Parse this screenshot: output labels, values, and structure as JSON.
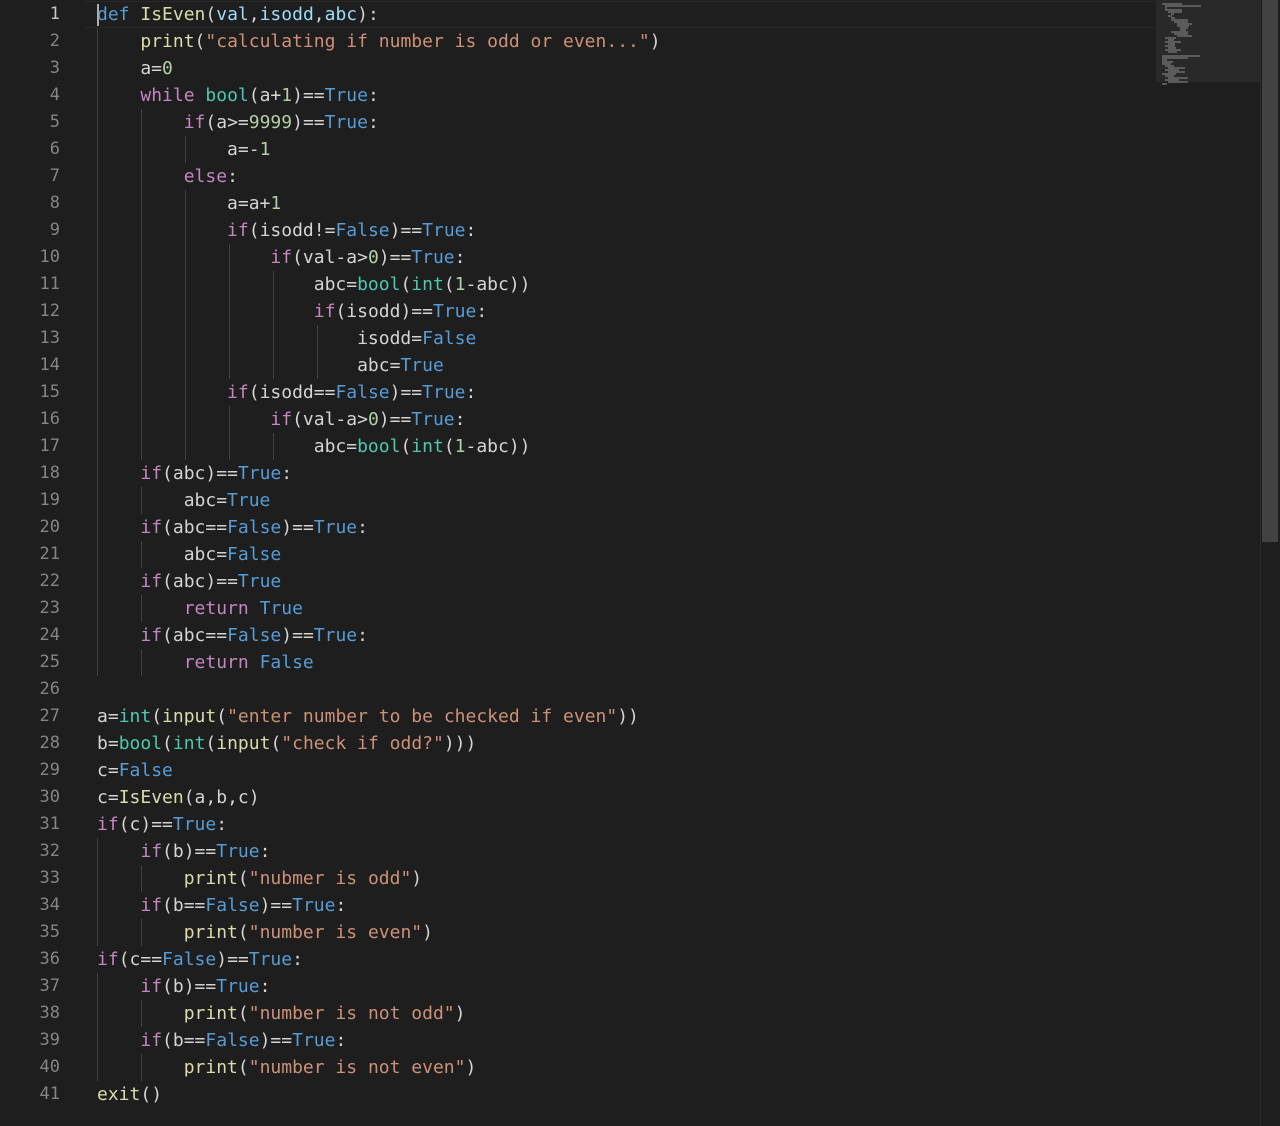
{
  "editor": {
    "active_line": 1,
    "line_numbers": [
      "1",
      "2",
      "3",
      "4",
      "5",
      "6",
      "7",
      "8",
      "9",
      "10",
      "11",
      "12",
      "13",
      "14",
      "15",
      "16",
      "17",
      "18",
      "19",
      "20",
      "21",
      "22",
      "23",
      "24",
      "25",
      "26",
      "27",
      "28",
      "29",
      "30",
      "31",
      "32",
      "33",
      "34",
      "35",
      "36",
      "37",
      "38",
      "39",
      "40",
      "41"
    ],
    "lines": [
      [
        [
          "def",
          "k-def"
        ],
        [
          " ",
          ""
        ],
        [
          "IsEven",
          "k-fn"
        ],
        [
          "(",
          ""
        ],
        [
          "val",
          "k-var"
        ],
        [
          ",",
          ""
        ],
        [
          "isodd",
          "k-var"
        ],
        [
          ",",
          ""
        ],
        [
          "abc",
          "k-var"
        ],
        [
          "):",
          ""
        ]
      ],
      [
        [
          "    ",
          ""
        ],
        [
          "print",
          "k-fn"
        ],
        [
          "(",
          ""
        ],
        [
          "\"calculating if number is odd or even...\"",
          "k-str"
        ],
        [
          ")",
          ""
        ]
      ],
      [
        [
          "    a=",
          ""
        ],
        [
          "0",
          "k-num"
        ]
      ],
      [
        [
          "    ",
          ""
        ],
        [
          "while",
          "k-kw"
        ],
        [
          " ",
          ""
        ],
        [
          "bool",
          "k-bi"
        ],
        [
          "(a+",
          ""
        ],
        [
          "1",
          "k-num"
        ],
        [
          ")==",
          ""
        ],
        [
          "True",
          "k-const"
        ],
        [
          ":",
          ""
        ]
      ],
      [
        [
          "        ",
          ""
        ],
        [
          "if",
          "k-kw"
        ],
        [
          "(a>=",
          ""
        ],
        [
          "9999",
          "k-num"
        ],
        [
          ")==",
          ""
        ],
        [
          "True",
          "k-const"
        ],
        [
          ":",
          ""
        ]
      ],
      [
        [
          "            a=-",
          ""
        ],
        [
          "1",
          "k-num"
        ]
      ],
      [
        [
          "        ",
          ""
        ],
        [
          "else",
          "k-kw"
        ],
        [
          ":",
          ""
        ]
      ],
      [
        [
          "            a=a+",
          ""
        ],
        [
          "1",
          "k-num"
        ]
      ],
      [
        [
          "            ",
          ""
        ],
        [
          "if",
          "k-kw"
        ],
        [
          "(isodd!=",
          ""
        ],
        [
          "False",
          "k-const"
        ],
        [
          ")==",
          ""
        ],
        [
          "True",
          "k-const"
        ],
        [
          ":",
          ""
        ]
      ],
      [
        [
          "                ",
          ""
        ],
        [
          "if",
          "k-kw"
        ],
        [
          "(val-a>",
          ""
        ],
        [
          "0",
          "k-num"
        ],
        [
          ")==",
          ""
        ],
        [
          "True",
          "k-const"
        ],
        [
          ":",
          ""
        ]
      ],
      [
        [
          "                    abc=",
          ""
        ],
        [
          "bool",
          "k-bi"
        ],
        [
          "(",
          ""
        ],
        [
          "int",
          "k-bi"
        ],
        [
          "(",
          ""
        ],
        [
          "1",
          "k-num"
        ],
        [
          "-abc))",
          ""
        ]
      ],
      [
        [
          "                    ",
          ""
        ],
        [
          "if",
          "k-kw"
        ],
        [
          "(isodd)==",
          ""
        ],
        [
          "True",
          "k-const"
        ],
        [
          ":",
          ""
        ]
      ],
      [
        [
          "                        isodd=",
          ""
        ],
        [
          "False",
          "k-const"
        ]
      ],
      [
        [
          "                        abc=",
          ""
        ],
        [
          "True",
          "k-const"
        ]
      ],
      [
        [
          "            ",
          ""
        ],
        [
          "if",
          "k-kw"
        ],
        [
          "(isodd==",
          ""
        ],
        [
          "False",
          "k-const"
        ],
        [
          ")==",
          ""
        ],
        [
          "True",
          "k-const"
        ],
        [
          ":",
          ""
        ]
      ],
      [
        [
          "                ",
          ""
        ],
        [
          "if",
          "k-kw"
        ],
        [
          "(val-a>",
          ""
        ],
        [
          "0",
          "k-num"
        ],
        [
          ")==",
          ""
        ],
        [
          "True",
          "k-const"
        ],
        [
          ":",
          ""
        ]
      ],
      [
        [
          "                    abc=",
          ""
        ],
        [
          "bool",
          "k-bi"
        ],
        [
          "(",
          ""
        ],
        [
          "int",
          "k-bi"
        ],
        [
          "(",
          ""
        ],
        [
          "1",
          "k-num"
        ],
        [
          "-abc))",
          ""
        ]
      ],
      [
        [
          "    ",
          ""
        ],
        [
          "if",
          "k-kw"
        ],
        [
          "(abc)==",
          ""
        ],
        [
          "True",
          "k-const"
        ],
        [
          ":",
          ""
        ]
      ],
      [
        [
          "        abc=",
          ""
        ],
        [
          "True",
          "k-const"
        ]
      ],
      [
        [
          "    ",
          ""
        ],
        [
          "if",
          "k-kw"
        ],
        [
          "(abc==",
          ""
        ],
        [
          "False",
          "k-const"
        ],
        [
          ")==",
          ""
        ],
        [
          "True",
          "k-const"
        ],
        [
          ":",
          ""
        ]
      ],
      [
        [
          "        abc=",
          ""
        ],
        [
          "False",
          "k-const"
        ]
      ],
      [
        [
          "    ",
          ""
        ],
        [
          "if",
          "k-kw"
        ],
        [
          "(abc)==",
          ""
        ],
        [
          "True",
          "k-const"
        ]
      ],
      [
        [
          "        ",
          ""
        ],
        [
          "return",
          "k-kw"
        ],
        [
          " ",
          ""
        ],
        [
          "True",
          "k-const"
        ]
      ],
      [
        [
          "    ",
          ""
        ],
        [
          "if",
          "k-kw"
        ],
        [
          "(abc==",
          ""
        ],
        [
          "False",
          "k-const"
        ],
        [
          ")==",
          ""
        ],
        [
          "True",
          "k-const"
        ],
        [
          ":",
          ""
        ]
      ],
      [
        [
          "        ",
          ""
        ],
        [
          "return",
          "k-kw"
        ],
        [
          " ",
          ""
        ],
        [
          "False",
          "k-const"
        ]
      ],
      [],
      [
        [
          "a=",
          ""
        ],
        [
          "int",
          "k-bi"
        ],
        [
          "(",
          ""
        ],
        [
          "input",
          "k-fn"
        ],
        [
          "(",
          ""
        ],
        [
          "\"enter number to be checked if even\"",
          "k-str"
        ],
        [
          "))",
          ""
        ]
      ],
      [
        [
          "b=",
          ""
        ],
        [
          "bool",
          "k-bi"
        ],
        [
          "(",
          ""
        ],
        [
          "int",
          "k-bi"
        ],
        [
          "(",
          ""
        ],
        [
          "input",
          "k-fn"
        ],
        [
          "(",
          ""
        ],
        [
          "\"check if odd?\"",
          "k-str"
        ],
        [
          ")))",
          ""
        ]
      ],
      [
        [
          "c=",
          ""
        ],
        [
          "False",
          "k-const"
        ]
      ],
      [
        [
          "c=",
          ""
        ],
        [
          "IsEven",
          "k-fn"
        ],
        [
          "(a,b,c)",
          ""
        ]
      ],
      [
        [
          "if",
          "k-kw"
        ],
        [
          "(c)==",
          ""
        ],
        [
          "True",
          "k-const"
        ],
        [
          ":",
          ""
        ]
      ],
      [
        [
          "    ",
          ""
        ],
        [
          "if",
          "k-kw"
        ],
        [
          "(b)==",
          ""
        ],
        [
          "True",
          "k-const"
        ],
        [
          ":",
          ""
        ]
      ],
      [
        [
          "        ",
          ""
        ],
        [
          "print",
          "k-fn"
        ],
        [
          "(",
          ""
        ],
        [
          "\"nubmer is odd\"",
          "k-str"
        ],
        [
          ")",
          ""
        ]
      ],
      [
        [
          "    ",
          ""
        ],
        [
          "if",
          "k-kw"
        ],
        [
          "(b==",
          ""
        ],
        [
          "False",
          "k-const"
        ],
        [
          ")==",
          ""
        ],
        [
          "True",
          "k-const"
        ],
        [
          ":",
          ""
        ]
      ],
      [
        [
          "        ",
          ""
        ],
        [
          "print",
          "k-fn"
        ],
        [
          "(",
          ""
        ],
        [
          "\"number is even\"",
          "k-str"
        ],
        [
          ")",
          ""
        ]
      ],
      [
        [
          "if",
          "k-kw"
        ],
        [
          "(c==",
          ""
        ],
        [
          "False",
          "k-const"
        ],
        [
          ")==",
          ""
        ],
        [
          "True",
          "k-const"
        ],
        [
          ":",
          ""
        ]
      ],
      [
        [
          "    ",
          ""
        ],
        [
          "if",
          "k-kw"
        ],
        [
          "(b)==",
          ""
        ],
        [
          "True",
          "k-const"
        ],
        [
          ":",
          ""
        ]
      ],
      [
        [
          "        ",
          ""
        ],
        [
          "print",
          "k-fn"
        ],
        [
          "(",
          ""
        ],
        [
          "\"number is not odd\"",
          "k-str"
        ],
        [
          ")",
          ""
        ]
      ],
      [
        [
          "    ",
          ""
        ],
        [
          "if",
          "k-kw"
        ],
        [
          "(b==",
          ""
        ],
        [
          "False",
          "k-const"
        ],
        [
          ")==",
          ""
        ],
        [
          "True",
          "k-const"
        ],
        [
          ":",
          ""
        ]
      ],
      [
        [
          "        ",
          ""
        ],
        [
          "print",
          "k-fn"
        ],
        [
          "(",
          ""
        ],
        [
          "\"number is not even\"",
          "k-str"
        ],
        [
          ")",
          ""
        ]
      ],
      [
        [
          "exit",
          "k-fn"
        ],
        [
          "()",
          ""
        ]
      ]
    ]
  },
  "theme": {
    "background": "#1e1e1e",
    "keyword": "#c586c0",
    "def_const": "#569cd6",
    "function": "#dcdcaa",
    "builtin": "#4ec9b0",
    "number": "#b5cea8",
    "string": "#ce9178",
    "default_text": "#d4d4d4",
    "line_number": "#858585"
  }
}
